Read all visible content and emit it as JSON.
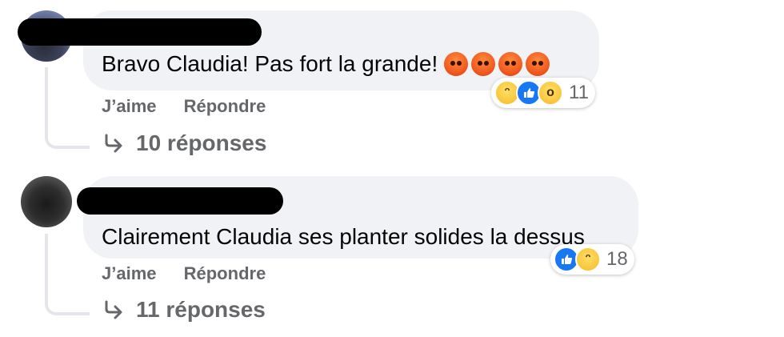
{
  "comments": [
    {
      "author": "",
      "text": "Bravo Claudia! Pas fort la grande!",
      "inline_emoji": [
        "angry-face",
        "angry-face",
        "angry-face",
        "angry-face"
      ],
      "reactions": {
        "icons": [
          "haha-icon",
          "like-icon",
          "wow-icon"
        ],
        "count": "11"
      },
      "actions": {
        "like": "J’aime",
        "reply": "Répondre"
      },
      "replies": "10 réponses"
    },
    {
      "author": "",
      "text": "Clairement Claudia ses planter solides la dessus",
      "reactions": {
        "icons": [
          "like-icon",
          "haha-icon"
        ],
        "count": "18"
      },
      "actions": {
        "like": "J’aime",
        "reply": "Répondre"
      },
      "replies": "11 réponses"
    }
  ],
  "colors": {
    "bubble": "#f0f2f5",
    "secondary_text": "#65676b",
    "like_blue": "#1877f2",
    "haha_yellow": "#f7b928",
    "angry_orange": "#f25b1f"
  }
}
